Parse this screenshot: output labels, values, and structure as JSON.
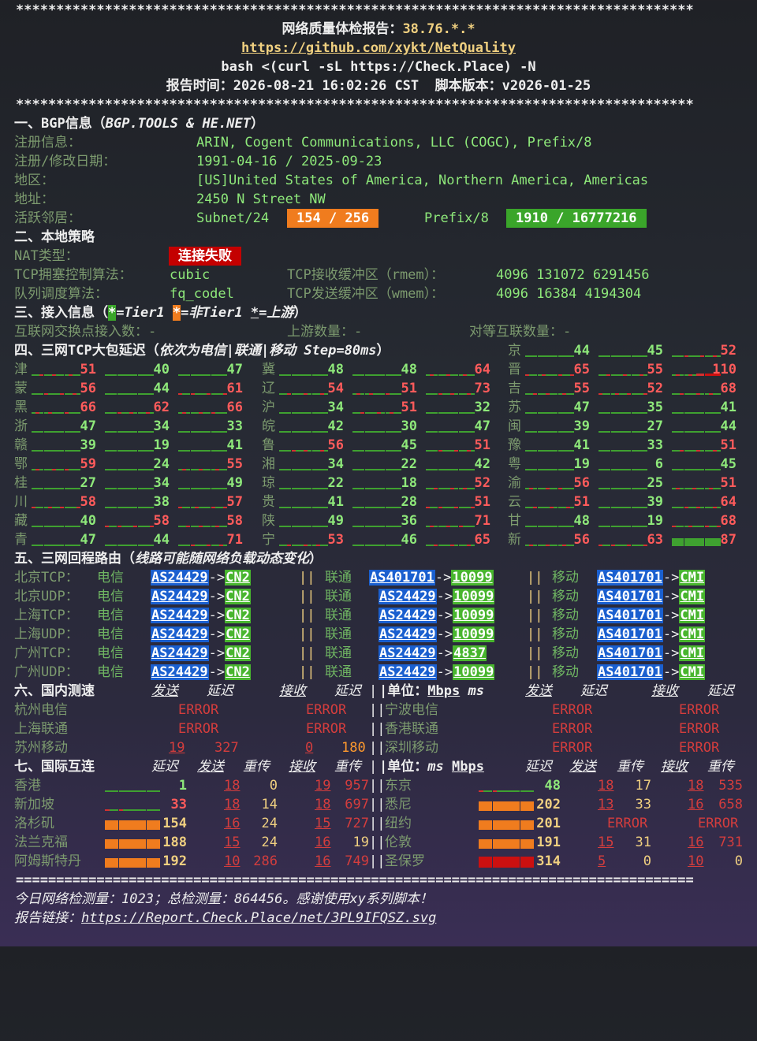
{
  "header": {
    "stars": "************************************************************************************",
    "title_label": "网络质量体检报告：",
    "ip": "38.76.*.*",
    "url": "https://github.com/xykt/NetQuality",
    "command": "bash <(curl -sL https://Check.Place) -N",
    "time_label": "报告时间：",
    "time": "2026-08-21 16:02:26 CST",
    "version_label": "脚本版本：",
    "version": "v2026-01-25"
  },
  "bgp": {
    "heading": "一、BGP信息（",
    "heading_src": "BGP.TOOLS & HE.NET",
    "heading_end": "）",
    "reg_label": "注册信息：",
    "reg_value": "ARIN, Cogent Communications, LLC (COGC), Prefix/8",
    "date_label": "注册/修改日期：",
    "date_value": "1991-04-16 / 2025-09-23",
    "region_label": "地区：",
    "region_value": "[US]United States of America, Northern America, Americas",
    "addr_label": "地址：",
    "addr_value": "2450 N Street NW",
    "neighbor_label": "活跃邻居：",
    "subnet_label": "Subnet/24",
    "subnet_value": "154 / 256",
    "prefix_label": "Prefix/8",
    "prefix_value": "1910 / 16777216"
  },
  "local": {
    "heading": "二、本地策略",
    "nat_label": "NAT类型：",
    "nat_value": "连接失败",
    "tcp_cc_label": "TCP拥塞控制算法：",
    "tcp_cc_value": "cubic",
    "rmem_label": "TCP接收缓冲区（rmem）：",
    "rmem_value": "4096 131072 6291456",
    "qdisc_label": "队列调度算法：",
    "qdisc_value": "fq_codel",
    "wmem_label": "TCP发送缓冲区（wmem）：",
    "wmem_value": "4096 16384 4194304"
  },
  "access": {
    "heading": "三、接入信息（",
    "star": "*",
    "tier1": "=Tier1 ",
    "non_tier1": "=非Tier1 ",
    "upstream": "=上游",
    "heading_end": "）",
    "ixp_label": "互联网交换点接入数：",
    "ixp_value": "-",
    "upstream_label": "上游数量：",
    "upstream_value": "-",
    "peer_label": "对等互联数量：",
    "peer_value": "-"
  },
  "latency": {
    "heading": "四、三网TCP大包延迟（",
    "heading_note": "依次为电信|联通|移动 Step=80ms",
    "heading_end": "）",
    "rows": [
      [
        null,
        null,
        {
          "p": "京",
          "v": [
            44,
            45,
            52
          ],
          "bars": [
            [
              "g",
              "g",
              "g",
              "g",
              "g",
              "g",
              "g",
              "g",
              "g",
              "g",
              "g",
              "g"
            ],
            [
              "g",
              "g",
              "g",
              "g",
              "g",
              "g",
              "g",
              "g",
              "g",
              "g",
              "g",
              "g"
            ],
            [
              "g",
              "g",
              "g",
              "g",
              "g",
              "g",
              "g",
              "g",
              "g",
              "g",
              "g",
              "g"
            ]
          ]
        }
      ],
      [
        {
          "p": "津",
          "v": [
            51,
            40,
            47
          ]
        },
        {
          "p": "冀",
          "v": [
            48,
            48,
            64
          ]
        },
        {
          "p": "晋",
          "v": [
            65,
            55,
            110
          ]
        }
      ],
      [
        {
          "p": "蒙",
          "v": [
            56,
            44,
            61
          ]
        },
        {
          "p": "辽",
          "v": [
            54,
            51,
            73
          ]
        },
        {
          "p": "吉",
          "v": [
            55,
            52,
            68
          ]
        }
      ],
      [
        {
          "p": "黑",
          "v": [
            66,
            62,
            66
          ]
        },
        {
          "p": "沪",
          "v": [
            34,
            51,
            32
          ]
        },
        {
          "p": "苏",
          "v": [
            47,
            35,
            41
          ]
        }
      ],
      [
        {
          "p": "浙",
          "v": [
            47,
            34,
            33
          ]
        },
        {
          "p": "皖",
          "v": [
            42,
            30,
            47
          ]
        },
        {
          "p": "闽",
          "v": [
            39,
            27,
            44
          ]
        }
      ],
      [
        {
          "p": "赣",
          "v": [
            39,
            19,
            41
          ]
        },
        {
          "p": "鲁",
          "v": [
            56,
            45,
            51
          ]
        },
        {
          "p": "豫",
          "v": [
            41,
            33,
            51
          ]
        }
      ],
      [
        {
          "p": "鄂",
          "v": [
            59,
            24,
            55
          ]
        },
        {
          "p": "湘",
          "v": [
            34,
            22,
            42
          ]
        },
        {
          "p": "粤",
          "v": [
            19,
            6,
            45
          ]
        }
      ],
      [
        {
          "p": "桂",
          "v": [
            27,
            34,
            49
          ]
        },
        {
          "p": "琼",
          "v": [
            22,
            18,
            52
          ]
        },
        {
          "p": "渝",
          "v": [
            56,
            25,
            51
          ]
        }
      ],
      [
        {
          "p": "川",
          "v": [
            58,
            38,
            57
          ]
        },
        {
          "p": "贵",
          "v": [
            41,
            28,
            51
          ]
        },
        {
          "p": "云",
          "v": [
            51,
            39,
            64
          ]
        }
      ],
      [
        {
          "p": "藏",
          "v": [
            40,
            58,
            58
          ]
        },
        {
          "p": "陕",
          "v": [
            49,
            36,
            71
          ]
        },
        {
          "p": "甘",
          "v": [
            48,
            19,
            68
          ]
        }
      ],
      [
        {
          "p": "青",
          "v": [
            47,
            44,
            71
          ]
        },
        {
          "p": "宁",
          "v": [
            53,
            46,
            65
          ]
        },
        {
          "p": "新",
          "v": [
            56,
            63,
            87
          ]
        }
      ]
    ]
  },
  "route": {
    "heading": "五、三网回程路由（",
    "heading_note": "线路可能随网络负载动态变化",
    "heading_end": "）",
    "rows": [
      {
        "loc": "北京TCP：",
        "ct_as": "AS24429",
        "ct_to": "CN2",
        "cu_as": "AS401701",
        "cu_to": "10099",
        "cm_as": "AS401701",
        "cm_to": "CMI"
      },
      {
        "loc": "北京UDP：",
        "ct_as": "AS24429",
        "ct_to": "CN2",
        "cu_as": "AS24429",
        "cu_to": "10099",
        "cm_as": "AS401701",
        "cm_to": "CMI"
      },
      {
        "loc": "上海TCP：",
        "ct_as": "AS24429",
        "ct_to": "CN2",
        "cu_as": "AS24429",
        "cu_to": "10099",
        "cm_as": "AS401701",
        "cm_to": "CMI"
      },
      {
        "loc": "上海UDP：",
        "ct_as": "AS24429",
        "ct_to": "CN2",
        "cu_as": "AS24429",
        "cu_to": "10099",
        "cm_as": "AS401701",
        "cm_to": "CMI"
      },
      {
        "loc": "广州TCP：",
        "ct_as": "AS24429",
        "ct_to": "CN2",
        "cu_as": "AS24429",
        "cu_to": "4837",
        "cm_as": "AS401701",
        "cm_to": "CMI"
      },
      {
        "loc": "广州UDP：",
        "ct_as": "AS24429",
        "ct_to": "CN2",
        "cu_as": "AS24429",
        "cu_to": "10099",
        "cm_as": "AS401701",
        "cm_to": "CMI"
      }
    ],
    "ct": "电信",
    "cu": "联通",
    "cm": "移动",
    "sep": "||",
    "arrow": "->"
  },
  "domestic": {
    "heading": "六、国内测速",
    "send": "发送",
    "latency": "延迟",
    "recv": "接收",
    "unit": "|单位：",
    "mbps": "Mbps",
    "ms": "ms",
    "rows": [
      {
        "l": "杭州电信",
        "l_send": "ERROR",
        "l_recv": "ERROR",
        "r": "宁波电信",
        "r_send": "ERROR",
        "r_recv": "ERROR"
      },
      {
        "l": "上海联通",
        "l_send": "ERROR",
        "l_recv": "ERROR",
        "r": "香港联通",
        "r_send": "ERROR",
        "r_recv": "ERROR"
      },
      {
        "l": "苏州移动",
        "l_send": "19",
        "l_lat1": "327",
        "l_recv": "0",
        "l_lat2": "180",
        "r": "深圳移动",
        "r_send": "ERROR",
        "r_recv": "ERROR"
      }
    ]
  },
  "intl": {
    "heading": "七、国际互连",
    "latency": "延迟",
    "send": "发送",
    "retrans": "重传",
    "recv": "接收",
    "unit": "|单位：",
    "ms": "ms",
    "mbps": "Mbps",
    "rows": [
      {
        "l": "香港",
        "l_lat": "1",
        "l_send": "18",
        "l_rt1": "0",
        "l_recv": "19",
        "l_rt2": "957",
        "r": "东京",
        "r_lat": "48",
        "r_send": "18",
        "r_rt1": "17",
        "r_recv": "18",
        "r_rt2": "535"
      },
      {
        "l": "新加坡",
        "l_lat": "33",
        "l_send": "18",
        "l_rt1": "14",
        "l_recv": "18",
        "l_rt2": "697",
        "r": "悉尼",
        "r_lat": "202",
        "r_send": "13",
        "r_rt1": "33",
        "r_recv": "16",
        "r_rt2": "658"
      },
      {
        "l": "洛杉矶",
        "l_lat": "154",
        "l_send": "16",
        "l_rt1": "24",
        "l_recv": "15",
        "l_rt2": "727",
        "r": "纽约",
        "r_lat": "201",
        "r_err1": "ERROR",
        "r_err2": "ERROR"
      },
      {
        "l": "法兰克福",
        "l_lat": "188",
        "l_send": "15",
        "l_rt1": "24",
        "l_recv": "16",
        "l_rt2": "19",
        "r": "伦敦",
        "r_lat": "191",
        "r_send": "15",
        "r_rt1": "31",
        "r_recv": "16",
        "r_rt2": "731"
      },
      {
        "l": "阿姆斯特丹",
        "l_lat": "192",
        "l_send": "10",
        "l_rt1": "286",
        "l_recv": "16",
        "l_rt2": "749",
        "r": "圣保罗",
        "r_lat": "314",
        "r_send": "5",
        "r_rt1": "0",
        "r_recv": "10",
        "r_rt2": "0"
      }
    ]
  },
  "footer": {
    "eqs": "====================================================================================",
    "count_line": "今日网络检测量：1023；总检测量：864456。感谢使用xy系列脚本！",
    "link_label": "报告链接：",
    "link": "https://Report.Check.Place/net/3PL9IFQSZ.svg"
  },
  "colors": {
    "green": "#8ee87a",
    "red": "#ff5b5b",
    "orange": "#ff9a2e",
    "as_blue": "#1a5fcf",
    "cn_green": "#48b52e"
  }
}
